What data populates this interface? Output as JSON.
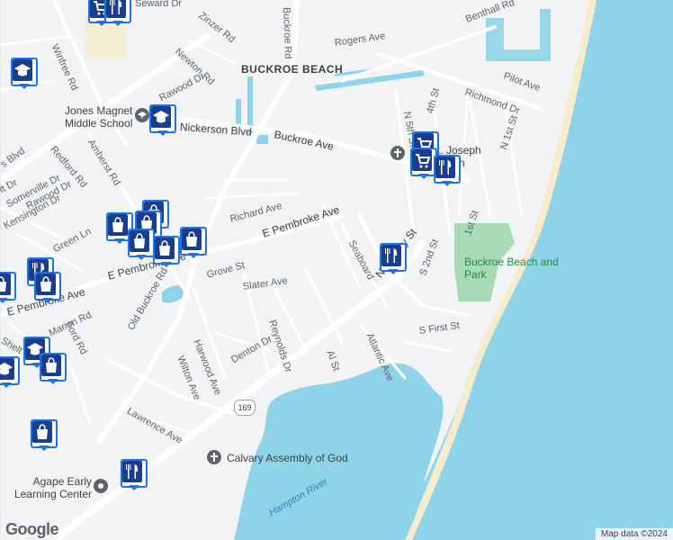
{
  "map": {
    "area_label": "BUCKROE BEACH",
    "roads": {
      "seward": "Seward Dr",
      "winfree": "Winfree Rd",
      "zinzer": "Zinzer Rd",
      "buckroe_rd": "Buckroe Rd",
      "old_buckroe": "Old Buckroe Rd",
      "newton": "Newton Rd",
      "rogers": "Rogers Ave",
      "benthall": "Benthall Rd",
      "pilot": "Pilot Ave",
      "richmond": "Richmond Dr",
      "n5th": "N 5th St",
      "n4th": "4th St",
      "n1st": "N 1st St",
      "rawood": "Rawood Dr",
      "nickerson": "Nickerson Blvd",
      "buckroe_ave": "Buckroe Ave",
      "amherst": "Amherst Rd",
      "redford": "Redford Rd",
      "somerville": "Somerville Dr",
      "rawood2": "Rawood Dr",
      "kensington": "Kensington Dr",
      "green_ln": "Green Ln",
      "richard": "Richard Ave",
      "pembroke1": "E Pembroke Ave",
      "pembroke2": "E Pembroke Ave",
      "pembroke3": "E Pembroke Ave",
      "grove": "Grove St",
      "slater": "Slater Ave",
      "reynolds": "Reynolds Dr",
      "seaboard": "Seaboard",
      "n_mallory": "N Mallory St",
      "s2nd": "S 2nd St",
      "first_st": "1st St",
      "s_first": "S First St",
      "atlantic": "Atlantic Ave",
      "al_st": "Al St",
      "harwood": "Harwood Ave",
      "wilton": "Wilton Ave",
      "denton": "Denton Dr",
      "ford": "Ford Rd",
      "marion": "Marion Rd",
      "lawrence": "Lawrence Ave",
      "blvd": "s Blvd",
      "shelt": "Shelt",
      "t_dr": "ft Dr"
    },
    "route_number": "169",
    "pois": {
      "school": "Jones Magnet Middle School",
      "church": "St. Joseph Church",
      "park": "Buckroe Beach and Park",
      "assembly": "Calvary Assembly of God",
      "agape": "Agape Early Learning Center",
      "river": "Hampton River"
    },
    "pin_icons": [
      "cart-icon",
      "restaurant-icon",
      "school-icon",
      "shopping-bag-icon"
    ],
    "colors": {
      "water": "#8fd3e8",
      "land": "#f1f3f4",
      "road": "#ffffff",
      "park": "#a8dab5",
      "beach": "#f6eccd",
      "pin_border": "#1a73e8",
      "pin_fill": "#1a3d8f"
    }
  },
  "branding": {
    "logo": "Google",
    "attribution": "Map data ©2024"
  }
}
